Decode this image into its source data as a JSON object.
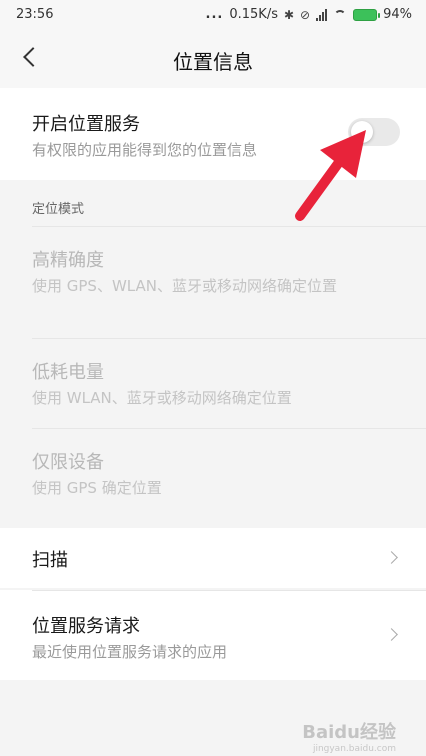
{
  "status_bar": {
    "time": "23:56",
    "dots": "...",
    "speed": "0.15K/s",
    "battery": "94%"
  },
  "header": {
    "title": "位置信息"
  },
  "location_service": {
    "title": "开启位置服务",
    "subtitle": "有权限的应用能得到您的位置信息",
    "enabled": false
  },
  "mode_section": {
    "header": "定位模式",
    "modes": [
      {
        "title": "高精确度",
        "subtitle": "使用 GPS、WLAN、蓝牙或移动网络确定位置"
      },
      {
        "title": "低耗电量",
        "subtitle": "使用 WLAN、蓝牙或移动网络确定位置"
      },
      {
        "title": "仅限设备",
        "subtitle": "使用 GPS 确定位置"
      }
    ]
  },
  "scan": {
    "title": "扫描"
  },
  "requests": {
    "title": "位置服务请求",
    "subtitle": "最近使用位置服务请求的应用"
  },
  "watermark": {
    "main": "Baidu经验",
    "sub": "jingyan.baidu.com"
  },
  "colors": {
    "accent_arrow": "#e8233a",
    "battery": "#3cc15a"
  }
}
